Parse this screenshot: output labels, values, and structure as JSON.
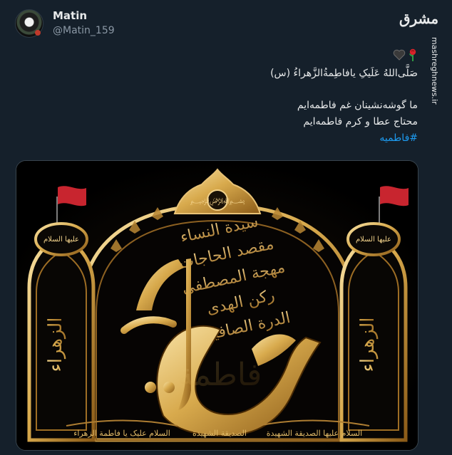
{
  "author": {
    "name": "Matin",
    "handle": "@Matin_159"
  },
  "watermark": {
    "brand": "مشرق",
    "site": "mashreghnews.ir"
  },
  "tweet": {
    "emojis": [
      "black-heart-icon",
      "rose-icon"
    ],
    "line1": "صَلَّی‌اللهُ عَلَیکِ یافاطِمةُالزَّهراءُ (س)",
    "line2": "ما گوشه‌نشینان غم فاطمه‌ایم",
    "line3": "محتاج عطا و کرم فاطمه‌ایم",
    "hashtag": "#فاطمیه"
  },
  "media": {
    "central_text": "فاطمة",
    "side_text": "الزهراء",
    "top_small": "علیها السلام",
    "names": [
      "سیدة النساء",
      "مقصد الحاجات",
      "مهجة المصطفی",
      "رکن الهدی",
      "الدرة الصافیة"
    ],
    "bottom_left": "السلام علیک یا فاطمة الزهراء",
    "bottom_center": "الصدیقة الشهیدة",
    "bottom_right": "السلام علیها الصدیقة الشهیدة",
    "colors": {
      "gold_light": "#f3d48a",
      "gold_dark": "#9a6a1e",
      "flag": "#c8252f",
      "background": "#050505"
    }
  }
}
